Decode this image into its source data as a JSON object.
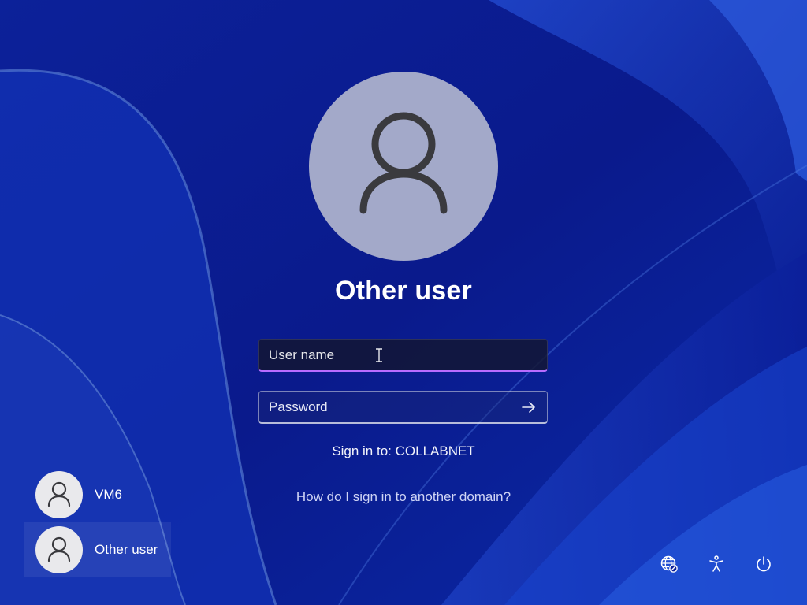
{
  "login": {
    "title": "Other user",
    "username_placeholder": "User name",
    "password_placeholder": "Password",
    "sign_in_to": "Sign in to: COLLABNET",
    "help_link": "How do I sign in to another domain?",
    "submit_icon": "arrow-right-icon"
  },
  "users": [
    {
      "name": "VM6",
      "icon": "person-icon",
      "selected": false
    },
    {
      "name": "Other user",
      "icon": "person-icon",
      "selected": true
    }
  ],
  "tray": [
    {
      "icon": "network-icon"
    },
    {
      "icon": "accessibility-icon"
    },
    {
      "icon": "power-icon"
    }
  ],
  "colors": {
    "wallpaper_base": "#0b1a8f",
    "avatar_background": "#a3a9c9",
    "focus_underline": "#b86cff",
    "text": "#ffffff"
  }
}
